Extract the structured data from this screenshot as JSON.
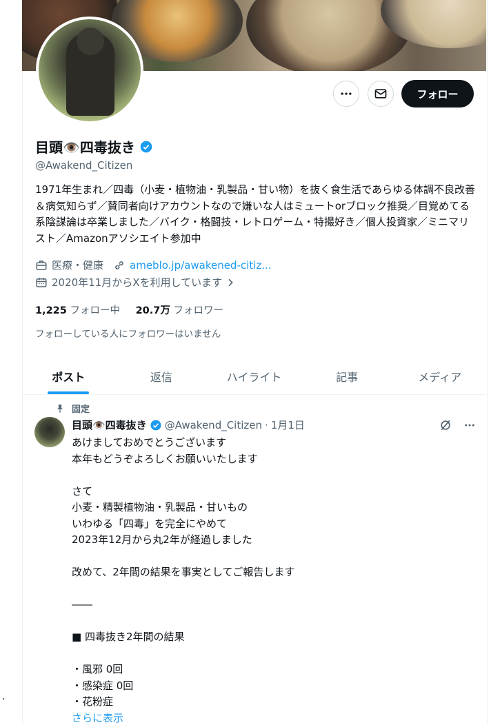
{
  "profile": {
    "name": "目頭👁️四毒抜き",
    "handle": "@Awakend_Citizen",
    "bio": "1971年生まれ／四毒（小麦・植物油・乳製品・甘い物）を抜く食生活であらゆる体調不良改善＆病気知らず／賛同者向けアカウントなので嫌いな人はミュートorブロック推奨／目覚めてる系陰謀論は卒業しました／バイク・格闘技・レトロゲーム・特撮好き／個人投資家／ミニマリスト／Amazonアソシエイト参加中",
    "category": "医療・健康",
    "link": "ameblo.jp/awakened-citiz...",
    "joined": "2020年11月からXを利用しています",
    "following_count": "1,225",
    "following_label": "フォロー中",
    "followers_count": "20.7万",
    "followers_label": "フォロワー",
    "no_mutual_followers": "フォローしている人にフォロワーはいません",
    "follow_button": "フォロー"
  },
  "tabs": [
    "ポスト",
    "返信",
    "ハイライト",
    "記事",
    "メディア"
  ],
  "post": {
    "pinned_label": "固定",
    "author_name": "目頭👁️四毒抜き",
    "author_handle": "@Awakend_Citizen",
    "date": "1月1日",
    "lines": [
      "あけましておめでとうございます",
      "本年もどうぞよろしくお願いいたします",
      "",
      "さて",
      "小麦・精製植物油・乳製品・甘いもの",
      "いわゆる「四毒」を完全にやめて",
      "2023年12月から丸2年が経過しました",
      "",
      "改めて、2年間の結果を事実としてご報告します",
      "",
      "――",
      "",
      "■ 四毒抜き2年間の結果",
      "",
      "・風邪 0回",
      "・感染症 0回",
      "・花粉症"
    ],
    "show_more": "さらに表示"
  },
  "colors": {
    "accent": "#1d9bf0",
    "text": "#0f1419",
    "secondary": "#536471"
  }
}
